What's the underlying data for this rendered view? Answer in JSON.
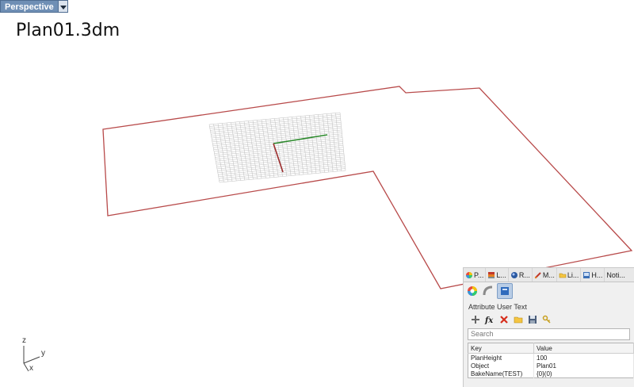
{
  "viewport": {
    "name_label": "Perspective",
    "file_title": "Plan01.3dm",
    "axis_labels": {
      "z": "z",
      "y": "y",
      "x": "x"
    }
  },
  "colors": {
    "outline": "#b84a4a",
    "grid": "#bdbdbd",
    "axis_green": "#2e8b2e",
    "axis_red": "#9b2d2d",
    "tab_accent": "#6f8fb5"
  },
  "panel": {
    "tabs": [
      {
        "label": "P...",
        "icon": "color-wheel-icon"
      },
      {
        "label": "L...",
        "icon": "layers-icon"
      },
      {
        "label": "R...",
        "icon": "render-icon"
      },
      {
        "label": "M...",
        "icon": "material-icon"
      },
      {
        "label": "Li...",
        "icon": "folder-icon"
      },
      {
        "label": "H...",
        "icon": "help-icon"
      },
      {
        "label": "Noti...",
        "icon": "notification-icon"
      }
    ],
    "sub_icons": [
      "properties-icon",
      "curve-icon",
      "attribute-text-icon"
    ],
    "group_title": "Attribute User Text",
    "tools": [
      "add-icon",
      "function-icon",
      "delete-icon",
      "open-icon",
      "save-icon",
      "key-icon"
    ],
    "search_placeholder": "Search",
    "table": {
      "headers": [
        "Key",
        "Value"
      ],
      "rows": [
        {
          "key": "PlanHeight",
          "value": "100"
        },
        {
          "key": "Object",
          "value": "Plan01"
        },
        {
          "key": "BakeName(TEST)",
          "value": "{0}(0)"
        }
      ]
    }
  }
}
